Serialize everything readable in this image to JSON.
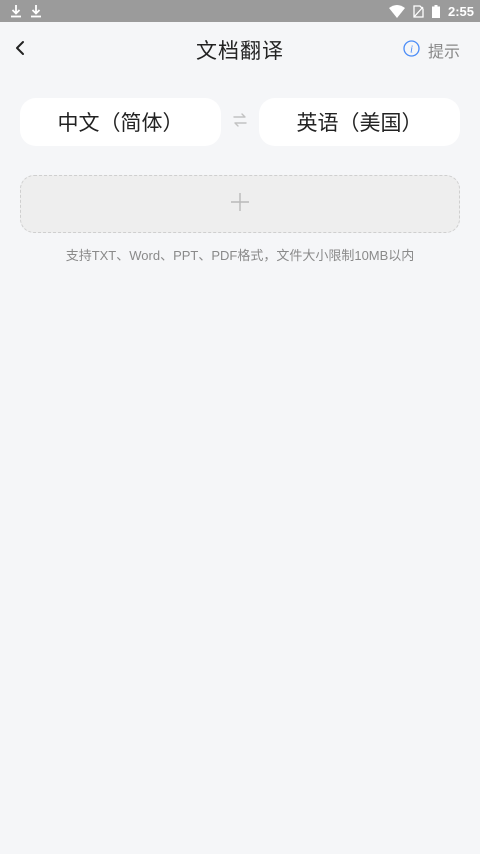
{
  "status_bar": {
    "left_icons": [
      "download-icon",
      "download-icon"
    ],
    "right_icons": [
      "wifi-icon",
      "no-sim-icon",
      "battery-icon"
    ],
    "time": "2:55",
    "background": "#9b9b9b"
  },
  "header": {
    "title": "文档翻译",
    "back_icon": "chevron-left-icon",
    "hint_icon": "info-icon",
    "hint_label": "提示",
    "accent": "#4a8cf7"
  },
  "language": {
    "source": "中文（简体）",
    "target": "英语（美国）",
    "swap_icon": "swap-icon"
  },
  "upload": {
    "icon": "plus-icon",
    "note": "支持TXT、Word、PPT、PDF格式，文件大小限制10MB以内"
  }
}
